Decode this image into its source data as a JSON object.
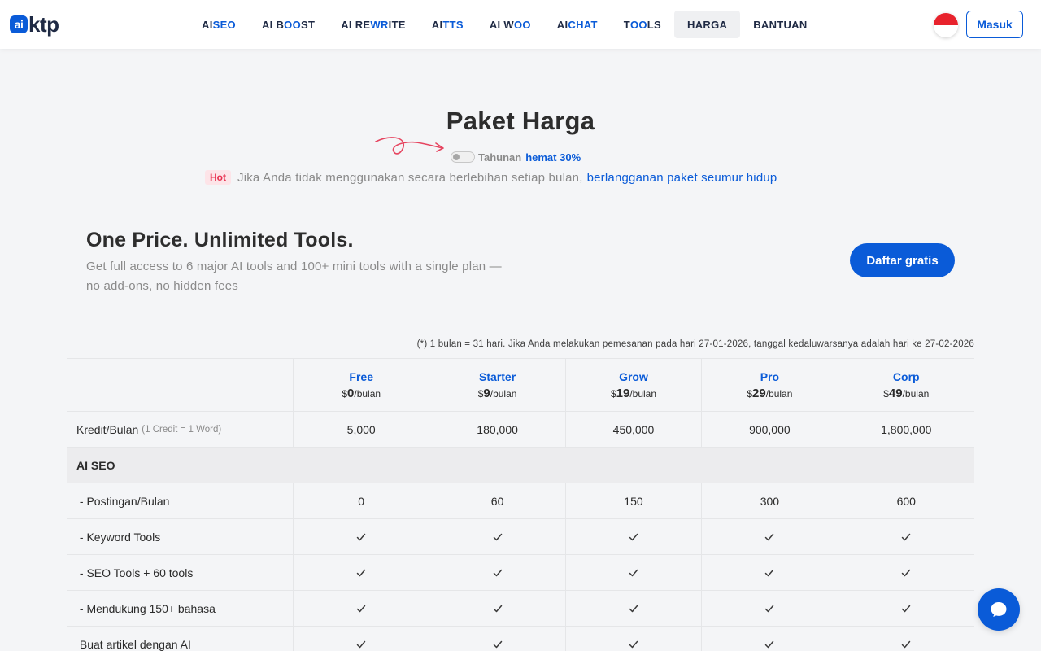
{
  "header": {
    "logo_badge": "ai",
    "logo_text": "ktp",
    "nav": [
      {
        "pre": "AI ",
        "hl": "SEO",
        "post": ""
      },
      {
        "pre": "AI B",
        "hl": "OO",
        "post": "ST"
      },
      {
        "pre": "AI RE",
        "hl": "WR",
        "post": "ITE"
      },
      {
        "pre": "AI ",
        "hl": "TTS",
        "post": ""
      },
      {
        "pre": "AI W",
        "hl": "OO",
        "post": ""
      },
      {
        "pre": "AI ",
        "hl": "CHAT",
        "post": ""
      },
      {
        "pre": "T",
        "hl": "OO",
        "post": "LS"
      },
      {
        "pre": "HARGA",
        "hl": "",
        "post": ""
      },
      {
        "pre": "BANTUAN",
        "hl": "",
        "post": ""
      }
    ],
    "login": "Masuk",
    "colors": {
      "accent": "#0a5bd8",
      "flag_top": "#e8222c",
      "flag_bottom": "#ffffff"
    }
  },
  "hero": {
    "title": "Paket Harga",
    "toggle_label": "Tahunan",
    "toggle_save": "hemat 30%",
    "hot_badge": "Hot",
    "hot_text": "Jika Anda tidak menggunakan secara berlebihan setiap bulan,",
    "hot_link": "berlangganan paket seumur hidup"
  },
  "promo": {
    "title": "One Price. Unlimited Tools.",
    "subtitle": "Get full access to 6 major AI tools and 100+ mini tools with a single plan — no add-ons, no hidden fees",
    "cta": "Daftar gratis"
  },
  "note": "(*) 1 bulan = 31 hari. Jika Anda melakukan pemesanan pada hari 27-01-2026, tanggal kedaluwarsanya adalah hari ke 27-02-2026",
  "plans": [
    {
      "name": "Free",
      "currency": "$",
      "price": "0",
      "period": "/bulan"
    },
    {
      "name": "Starter",
      "currency": "$",
      "price": "9",
      "period": "/bulan"
    },
    {
      "name": "Grow",
      "currency": "$",
      "price": "19",
      "period": "/bulan"
    },
    {
      "name": "Pro",
      "currency": "$",
      "price": "29",
      "period": "/bulan"
    },
    {
      "name": "Corp",
      "currency": "$",
      "price": "49",
      "period": "/bulan"
    }
  ],
  "rows": [
    {
      "type": "value",
      "label": "Kredit/Bulan",
      "sub": "(1 Credit = 1 Word)",
      "values": [
        "5,000",
        "180,000",
        "450,000",
        "900,000",
        "1,800,000"
      ]
    },
    {
      "type": "section",
      "label": "AI SEO"
    },
    {
      "type": "value",
      "label": " - Postingan/Bulan",
      "values": [
        "0",
        "60",
        "150",
        "300",
        "600"
      ]
    },
    {
      "type": "check",
      "label": " - Keyword Tools",
      "values": [
        true,
        true,
        true,
        true,
        true
      ]
    },
    {
      "type": "check",
      "label": " - SEO Tools + 60 tools",
      "values": [
        true,
        true,
        true,
        true,
        true
      ]
    },
    {
      "type": "check",
      "label": " - Mendukung 150+ bahasa",
      "values": [
        true,
        true,
        true,
        true,
        true
      ]
    },
    {
      "type": "check",
      "label": " Buat artikel dengan AI",
      "values": [
        true,
        true,
        true,
        true,
        true
      ]
    }
  ]
}
